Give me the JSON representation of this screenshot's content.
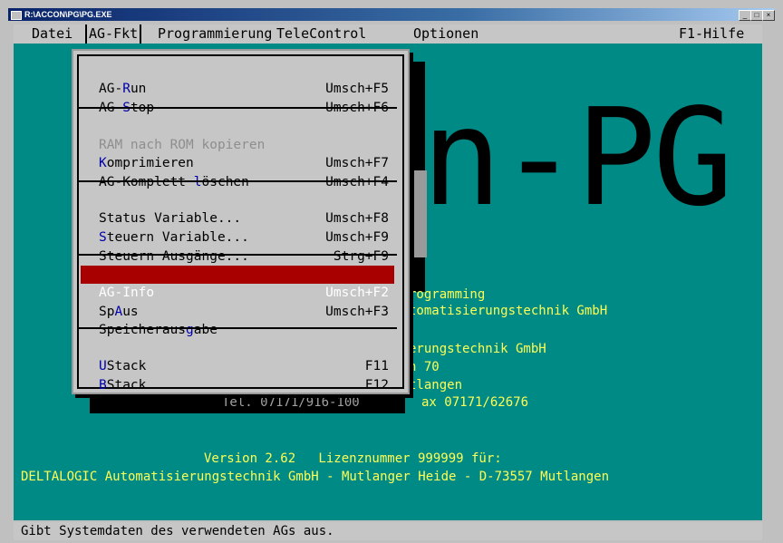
{
  "window": {
    "title": "R:\\ACCON\\PG\\PG.EXE",
    "min": "_",
    "max": "□",
    "close": "×"
  },
  "menubar": [
    "Datei",
    "AG-Fkt",
    "Programmierung",
    "TeleControl",
    "Optionen"
  ],
  "help": "F1-Hilfe",
  "dropdown": [
    {
      "label": "AG-Run",
      "hot": "R",
      "key": "Umsch+F5"
    },
    {
      "label": "AG-Stop",
      "hot": "S",
      "key": "Umsch+F6"
    },
    {
      "label": "RAM nach ROM kopieren",
      "disabled": true,
      "key": ""
    },
    {
      "label": "Komprimieren",
      "hot": "K",
      "key": "Umsch+F7"
    },
    {
      "label": "AG-Komplett löschen",
      "hot": "l",
      "key": "Umsch+F4"
    },
    {
      "label": "Status Variable...",
      "key": "Umsch+F8"
    },
    {
      "label": "Steuern Variable...",
      "hot": "S",
      "key": "Umsch+F9"
    },
    {
      "label": "Steuern Ausgänge...",
      "key": "Strg+F9"
    },
    {
      "label": "AG-Info",
      "hot": "I",
      "key": "Umsch+F2",
      "selected": true
    },
    {
      "label": "SpAus",
      "hot": "A",
      "key": "Umsch+F3"
    },
    {
      "label": "Speicherausgabe",
      "hot": "g",
      "key": ""
    },
    {
      "label": "UStack",
      "hot": "U",
      "key": "F11"
    },
    {
      "label": "BStack",
      "hot": "B",
      "key": "F12"
    }
  ],
  "logo": {
    "big": "n-PG"
  },
  "info": {
    "line1": "rogramming",
    "line2": "tomatisierungstechnik GmbH",
    "line3": "erungstechnik GmbH",
    "line4": "h 70",
    "line5": "tlangen",
    "tel": "Tel. 07171/916-100",
    "fax": "ax 07171/62676"
  },
  "version_line": "Version 2.62   Lizenznummer 999999 für:",
  "company_line": "DELTALOGIC Automatisierungstechnik GmbH - Mutlanger Heide - D-73557 Mutlangen",
  "status": "Gibt Systemdaten des verwendeten AGs aus.",
  "colors": {
    "desktop": "#008a86",
    "highlight": "#a80000",
    "hotkey": "#0000a8",
    "infoText": "#ffff54"
  }
}
